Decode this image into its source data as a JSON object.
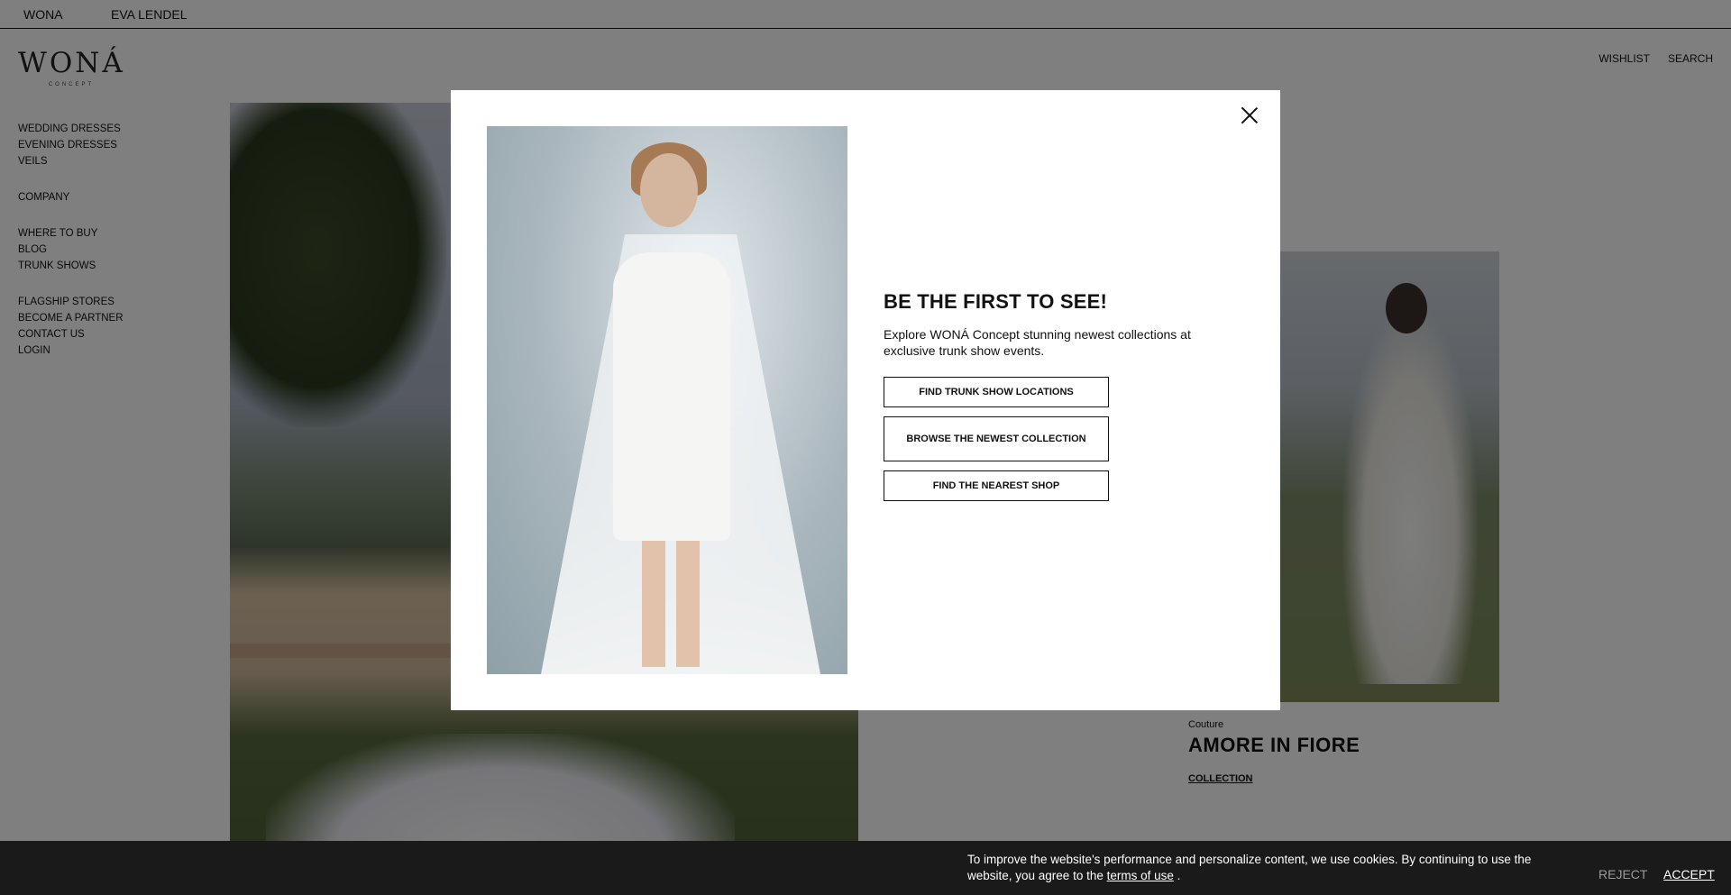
{
  "topbar": {
    "links": [
      "WONA",
      "EVA LENDEL"
    ]
  },
  "header": {
    "logo": "WONÁ",
    "logo_sub": "CONCEPT",
    "wishlist": "WISHLIST",
    "search": "SEARCH"
  },
  "sidebar": {
    "groups": [
      [
        "WEDDING DRESSES",
        "EVENING DRESSES",
        "VEILS"
      ],
      [
        "COMPANY"
      ],
      [
        "WHERE TO BUY",
        "BLOG",
        "TRUNK SHOWS"
      ],
      [
        "FLAGSHIP STORES",
        "BECOME A PARTNER",
        "CONTACT US",
        "LOGIN"
      ]
    ]
  },
  "collection": {
    "category": "Couture",
    "title": "AMORE IN FIORE",
    "link": "COLLECTION"
  },
  "modal": {
    "heading": "BE THE FIRST TO SEE!",
    "text": "Explore WONÁ Concept stunning newest collections at exclusive trunk show events.",
    "buttons": [
      "FIND TRUNK SHOW LOCATIONS",
      "BROWSE THE NEWEST COLLECTION",
      "FIND THE NEAREST SHOP"
    ]
  },
  "cookie": {
    "text": "To improve the website's performance and personalize content, we use cookies. By continuing to use the website, you agree to the",
    "terms": "terms of use",
    "suffix": ".",
    "reject": "REJECT",
    "accept": "ACCEPT"
  }
}
